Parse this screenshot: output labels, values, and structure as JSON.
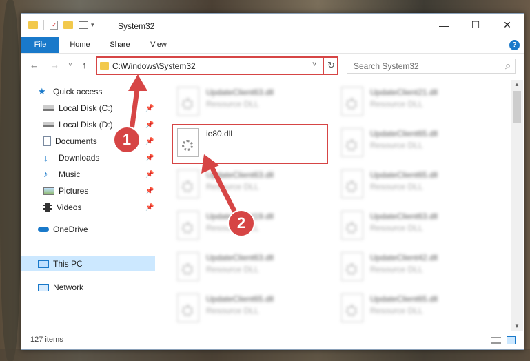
{
  "window": {
    "title": "System32",
    "close_glyph": "✕",
    "maximize_glyph": "☐",
    "minimize_glyph": "—"
  },
  "ribbon": {
    "tabs": [
      "File",
      "Home",
      "Share",
      "View"
    ],
    "help_label": "?"
  },
  "nav": {
    "back_glyph": "←",
    "forward_glyph": "→",
    "recent_glyph": "˅",
    "up_glyph": "↑",
    "address": "C:\\Windows\\System32",
    "dropdown_glyph": "˅",
    "refresh_glyph": "↻",
    "search_placeholder": "Search System32",
    "search_glyph": "⌕"
  },
  "sidebar": {
    "items": [
      {
        "label": "Quick access",
        "pinned": false
      },
      {
        "label": "Local Disk (C:)",
        "pinned": true
      },
      {
        "label": "Local Disk (D:)",
        "pinned": true
      },
      {
        "label": "Documents",
        "pinned": true
      },
      {
        "label": "Downloads",
        "pinned": true
      },
      {
        "label": "Music",
        "pinned": true
      },
      {
        "label": "Pictures",
        "pinned": true
      },
      {
        "label": "Videos",
        "pinned": true
      },
      {
        "label": "OneDrive",
        "pinned": false
      },
      {
        "label": "This PC",
        "pinned": false,
        "selected": true
      },
      {
        "label": "Network",
        "pinned": false
      }
    ],
    "pin_glyph": "📌"
  },
  "files": [
    {
      "name": "UpdateClient63.dll",
      "type": "Resource DLL",
      "blurred": true
    },
    {
      "name": "UpdateClient21.dll",
      "type": "Resource DLL",
      "blurred": true
    },
    {
      "name": "ie80.dll",
      "type": "",
      "blurred": false,
      "highlighted": true
    },
    {
      "name": "UpdateClient65.dll",
      "type": "Resource DLL",
      "blurred": true
    },
    {
      "name": "UpdateClient63.dll",
      "type": "Resource DLL",
      "blurred": true
    },
    {
      "name": "UpdateClient65.dll",
      "type": "Resource DLL",
      "blurred": true
    },
    {
      "name": "UpdateClient19.dll",
      "type": "Resource DLL",
      "blurred": true
    },
    {
      "name": "UpdateClient63.dll",
      "type": "Resource DLL",
      "blurred": true
    },
    {
      "name": "UpdateClient63.dll",
      "type": "Resource DLL",
      "blurred": true
    },
    {
      "name": "UpdateClient42.dll",
      "type": "Resource DLL",
      "blurred": true
    },
    {
      "name": "UpdateClient65.dll",
      "type": "Resource DLL",
      "blurred": true
    },
    {
      "name": "UpdateClient65.dll",
      "type": "Resource DLL",
      "blurred": true
    }
  ],
  "status": {
    "item_count": "127 items"
  },
  "annotations": {
    "badge1": "1",
    "badge2": "2",
    "accent": "#d64545"
  }
}
